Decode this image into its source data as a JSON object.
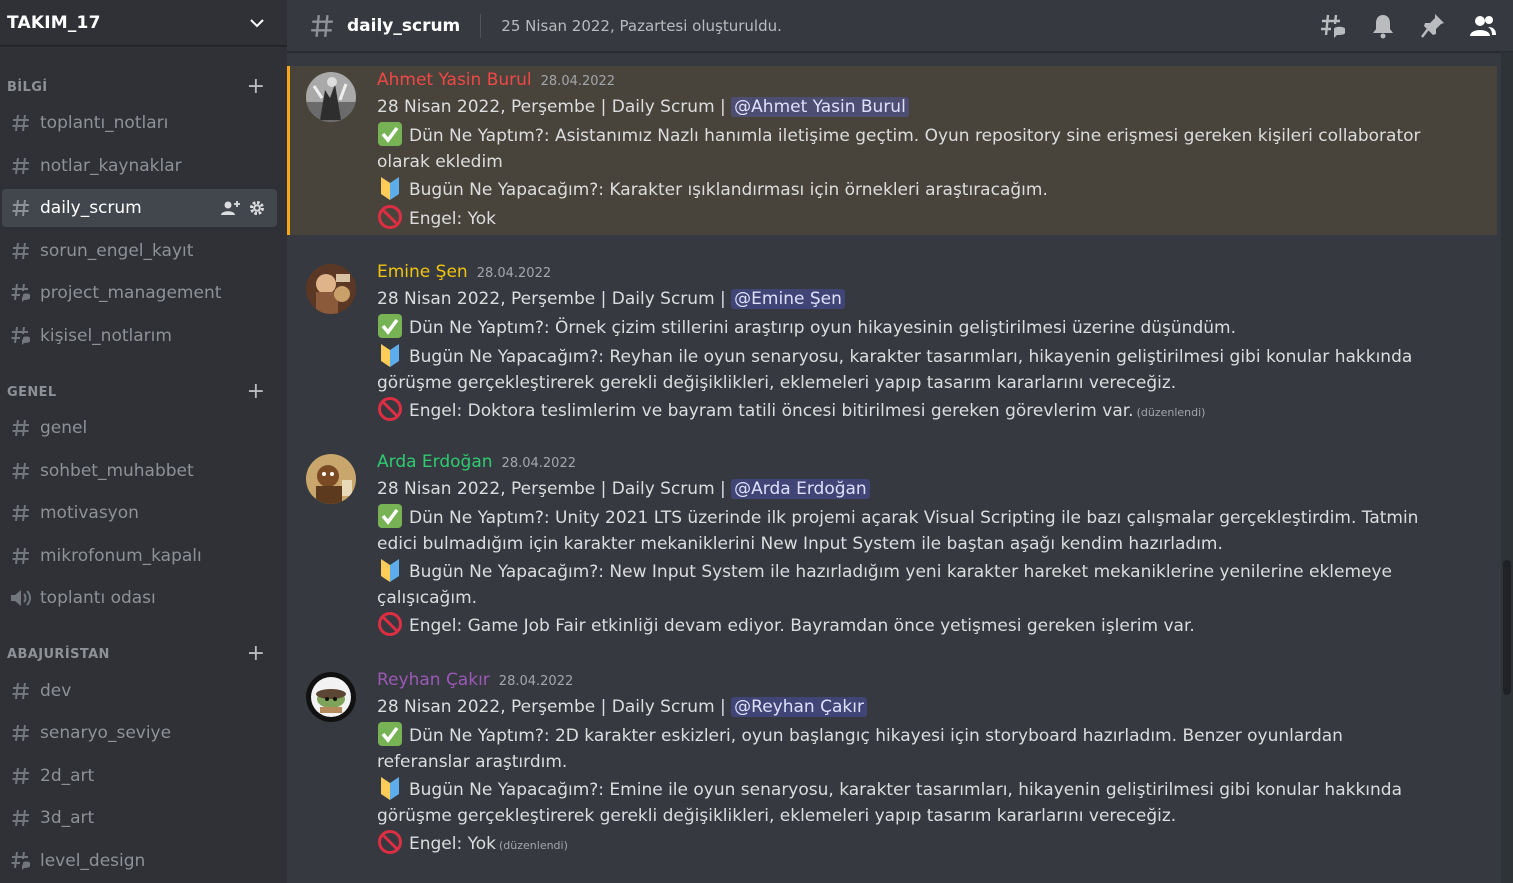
{
  "server": {
    "name": "TAKIM_17"
  },
  "categories": [
    {
      "label": "BİLGİ"
    },
    {
      "label": "GENEL"
    },
    {
      "label": "ABAJURİSTAN"
    }
  ],
  "channels": [
    {
      "label": "toplantı_notları",
      "icon": "hash-icon"
    },
    {
      "label": "notlar_kaynaklar",
      "icon": "hash-icon"
    },
    {
      "label": "daily_scrum",
      "icon": "hash-icon",
      "active": true
    },
    {
      "label": "sorun_engel_kayıt",
      "icon": "hash-icon"
    },
    {
      "label": "project_management",
      "icon": "hash-thread-icon"
    },
    {
      "label": "kişisel_notlarım",
      "icon": "hash-thread-icon"
    },
    {
      "label": "genel",
      "icon": "hash-icon"
    },
    {
      "label": "sohbet_muhabbet",
      "icon": "hash-icon"
    },
    {
      "label": "motivasyon",
      "icon": "hash-icon"
    },
    {
      "label": "mikrofonum_kapalı",
      "icon": "hash-icon"
    },
    {
      "label": "toplantı odası",
      "icon": "speaker-icon"
    },
    {
      "label": "dev",
      "icon": "hash-icon"
    },
    {
      "label": "senaryo_seviye",
      "icon": "hash-icon"
    },
    {
      "label": "2d_art",
      "icon": "hash-icon"
    },
    {
      "label": "3d_art",
      "icon": "hash-icon"
    },
    {
      "label": "level_design",
      "icon": "hash-thread-icon"
    }
  ],
  "topbar": {
    "channel_name": "daily_scrum",
    "topic": "25 Nisan 2022, Pazartesi oluşturuldu.",
    "icons": [
      "threads-icon",
      "bell-icon",
      "pin-icon",
      "members-icon"
    ]
  },
  "messages": [
    {
      "author": "Ahmet Yasin Burul",
      "author_color": "#f04747",
      "timestamp": "28.04.2022",
      "header_line": "28 Nisan 2022, Perşembe | Daily Scrum | ",
      "mention": "@Ahmet Yasin Burul",
      "yesterday": "Dün Ne Yaptım?: Asistanımız Nazlı hanımla iletişime geçtim. Oyun repository sine erişmesi gereken kişileri collaborator olarak ekledim",
      "today": "Bugün Ne Yapacağım?: Karakter ışıklandırması için örnekleri araştıracağım.",
      "blocker": "Engel: Yok",
      "edited": ""
    },
    {
      "author": "Emine Şen",
      "author_color": "#f1c40f",
      "timestamp": "28.04.2022",
      "header_line": "28 Nisan 2022, Perşembe | Daily Scrum | ",
      "mention": "@Emine Şen",
      "yesterday": "Dün Ne Yaptım?: Örnek çizim stillerini araştırıp oyun hikayesinin geliştirilmesi üzerine düşündüm.",
      "today": "Bugün Ne Yapacağım?: Reyhan ile oyun senaryosu, karakter tasarımları, hikayenin geliştirilmesi gibi konular hakkında görüşme gerçekleştirerek gerekli değişiklikleri, eklemeleri yapıp tasarım kararlarını vereceğiz.",
      "blocker": "Engel: Doktora teslimlerim ve bayram tatili öncesi bitirilmesi gereken görevlerim var.",
      "edited": "(düzenlendi)"
    },
    {
      "author": "Arda Erdoğan",
      "author_color": "#2ecc71",
      "timestamp": "28.04.2022",
      "header_line": "28 Nisan 2022, Perşembe | Daily Scrum | ",
      "mention": "@Arda Erdoğan",
      "yesterday": "Dün Ne Yaptım?: Unity 2021 LTS üzerinde ilk projemi açarak Visual Scripting ile bazı çalışmalar gerçekleştirdim. Tatmin edici bulmadığım için karakter mekaniklerini New Input System ile baştan aşağı kendim hazırladım.",
      "today": "Bugün Ne Yapacağım?: New Input System ile hazırladığım yeni karakter hareket mekaniklerine yenilerine eklemeye çalışıcağım.",
      "blocker": "Engel: Game Job Fair etkinliği devam ediyor. Bayramdan önce yetişmesi gereken işlerim var.",
      "edited": ""
    },
    {
      "author": "Reyhan Çakır",
      "author_color": "#9b59b6",
      "timestamp": "28.04.2022",
      "header_line": "28 Nisan 2022, Perşembe | Daily Scrum | ",
      "mention": "@Reyhan Çakır",
      "yesterday": "Dün Ne Yaptım?: 2D karakter eskizleri, oyun başlangıç hikayesi için storyboard hazırladım. Benzer oyunlardan referanslar araştırdım.",
      "today": "Bugün Ne Yapacağım?: Emine ile oyun senaryosu, karakter tasarımları, hikayenin geliştirilmesi gibi konular hakkında görüşme gerçekleştirerek gerekli değişiklikleri, eklemeleri yapıp tasarım kararlarını vereceğiz.",
      "blocker": "Engel: Yok",
      "edited": "(düzenlendi)"
    }
  ]
}
